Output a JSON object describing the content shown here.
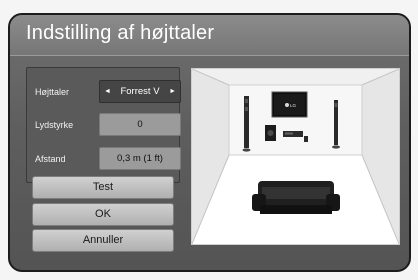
{
  "dialog": {
    "title": "Indstilling af højttaler"
  },
  "settings": {
    "speaker_label": "Højttaler",
    "speaker_value": "Forrest V",
    "volume_label": "Lydstyrke",
    "volume_value": "0",
    "distance_label": "Afstand",
    "distance_value": "0,3 m (1 ft)"
  },
  "buttons": {
    "test": "Test",
    "ok": "OK",
    "cancel": "Annuller"
  },
  "room": {
    "tv_logo": "LG"
  },
  "icons": {
    "arrow_left": "◄",
    "arrow_right": "►"
  }
}
